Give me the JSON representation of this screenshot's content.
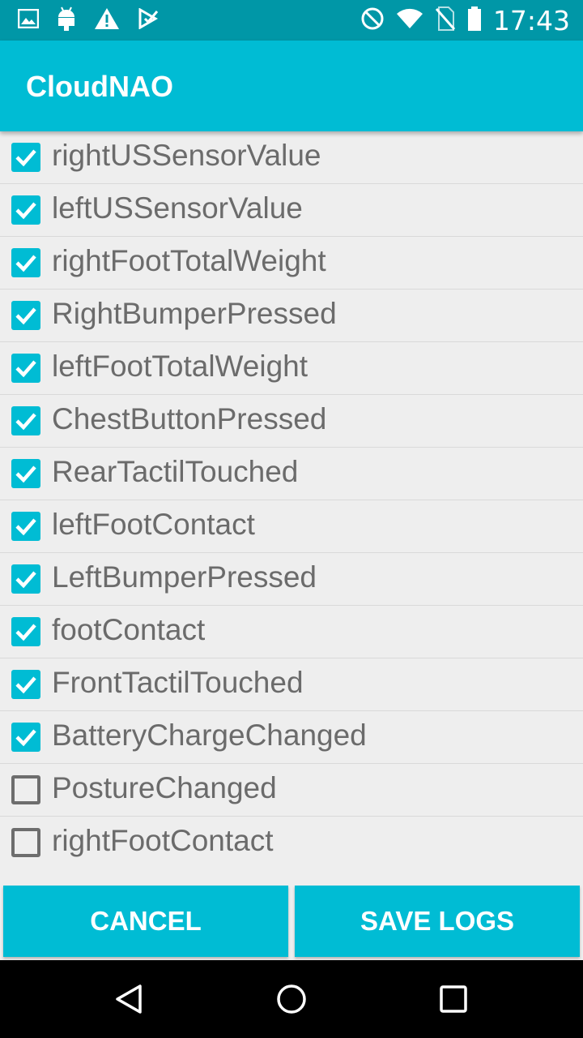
{
  "status_bar": {
    "time": "17:43",
    "left_icons": [
      "image-icon",
      "android-icon",
      "warning-icon",
      "check-app-icon"
    ],
    "right_icons": [
      "do-not-disturb-icon",
      "wifi-icon",
      "no-sim-icon",
      "battery-icon"
    ]
  },
  "app_bar": {
    "title": "CloudNAO"
  },
  "options": [
    {
      "label": "rightUSSensorValue",
      "checked": true
    },
    {
      "label": "leftUSSensorValue",
      "checked": true
    },
    {
      "label": "rightFootTotalWeight",
      "checked": true
    },
    {
      "label": "RightBumperPressed",
      "checked": true
    },
    {
      "label": "leftFootTotalWeight",
      "checked": true
    },
    {
      "label": "ChestButtonPressed",
      "checked": true
    },
    {
      "label": "RearTactilTouched",
      "checked": true
    },
    {
      "label": "leftFootContact",
      "checked": true
    },
    {
      "label": "LeftBumperPressed",
      "checked": true
    },
    {
      "label": "footContact",
      "checked": true
    },
    {
      "label": "FrontTactilTouched",
      "checked": true
    },
    {
      "label": "BatteryChargeChanged",
      "checked": true
    },
    {
      "label": "PostureChanged",
      "checked": false
    },
    {
      "label": "rightFootContact",
      "checked": false
    }
  ],
  "buttons": {
    "cancel": "CANCEL",
    "save": "SAVE LOGS"
  },
  "nav_bar": {
    "icons": [
      "back-icon",
      "home-icon",
      "recents-icon"
    ]
  },
  "colors": {
    "accent": "#00bcd4",
    "status_bar": "#0097a7",
    "background": "#eeeeee",
    "text": "#6b6b6b"
  }
}
